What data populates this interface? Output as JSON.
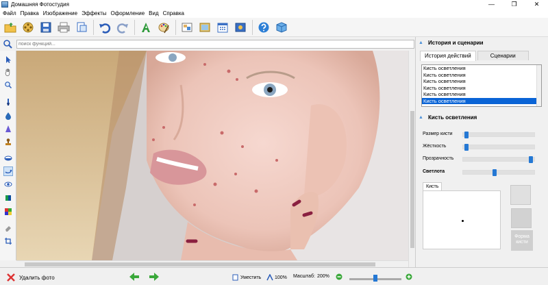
{
  "app": {
    "title": "Домашняя Фотостудия"
  },
  "window_controls": {
    "minimize": "—",
    "maximize": "❐",
    "close": "✕"
  },
  "menu": [
    "Файл",
    "Правка",
    "Изображение",
    "Эффекты",
    "Оформление",
    "Вид",
    "Справка"
  ],
  "search": {
    "placeholder": "поиск функций...",
    "value": ""
  },
  "panel": {
    "history_title": "История и сценарии",
    "tabs": [
      "История действий",
      "Сценарии"
    ],
    "history_items": [
      "Кисть осветления",
      "Кисть осветления",
      "Кисть осветления",
      "Кисть осветления",
      "Кисть осветления",
      "Кисть осветления"
    ],
    "selected_index": 5,
    "brush_title": "Кисть осветления",
    "sliders": [
      {
        "label": "Размер кисти",
        "value": 0.02
      },
      {
        "label": "Жёсткость",
        "value": 0.02
      },
      {
        "label": "Прозрачность",
        "value": 0.98
      },
      {
        "label": "Светлота",
        "value": 0.44
      }
    ],
    "brush_tab": "Кисть",
    "form_button": "Форма кисти"
  },
  "status": {
    "delete_photo": "Удалить фото",
    "fit": "Уместить",
    "hundred": "100%",
    "scale_label": "Масштаб:",
    "scale_value": "200%",
    "zoom_level": 0.5
  },
  "colors": {
    "accent": "#2478d4",
    "selection": "#0a64d6"
  }
}
